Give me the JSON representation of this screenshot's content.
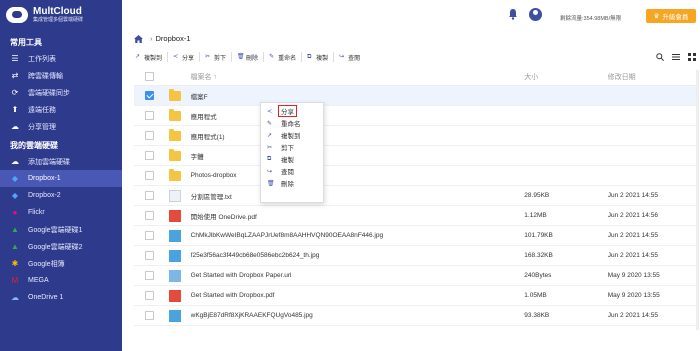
{
  "app": {
    "logo_title": "MultCloud",
    "logo_subtitle": "集成管理多個雲端硬碟",
    "brand_color": "#2e3a8c",
    "accent_color": "#3f8ff0"
  },
  "sidebar": {
    "tools_title": "常用工具",
    "tools": [
      {
        "label": "工作列表",
        "icon": "list-icon"
      },
      {
        "label": "跨雲碟傳輸",
        "icon": "transfer-icon"
      },
      {
        "label": "雲端硬碟同步",
        "icon": "sync-icon"
      },
      {
        "label": "遠端任務",
        "icon": "remote-icon"
      },
      {
        "label": "分享管理",
        "icon": "share-manage-icon"
      }
    ],
    "drives_title": "我的雲端硬碟",
    "drives": [
      {
        "label": "添加雲端硬碟",
        "icon": "add-cloud-icon"
      },
      {
        "label": "Dropbox-1",
        "icon": "dropbox-icon",
        "active": true
      },
      {
        "label": "Dropbox-2",
        "icon": "dropbox-icon"
      },
      {
        "label": "Flickr",
        "icon": "flickr-icon"
      },
      {
        "label": "Google雲端硬碟1",
        "icon": "google-drive-icon"
      },
      {
        "label": "Google雲端硬碟2",
        "icon": "google-drive-icon"
      },
      {
        "label": "Google相簿",
        "icon": "google-photos-icon"
      },
      {
        "label": "MEGA",
        "icon": "mega-icon"
      },
      {
        "label": "OneDrive 1",
        "icon": "onedrive-icon"
      }
    ]
  },
  "header": {
    "traffic_text": "剩餘流量:354.98MB/無限",
    "upgrade_label": "升級會員"
  },
  "breadcrumb": {
    "current": "Dropbox-1"
  },
  "toolbar": {
    "items": [
      {
        "label": "複製到",
        "icon": "copy-to-icon"
      },
      {
        "label": "分享",
        "icon": "share-icon"
      },
      {
        "label": "剪下",
        "icon": "cut-icon"
      },
      {
        "label": "刪除",
        "icon": "delete-icon"
      },
      {
        "label": "重命名",
        "icon": "rename-icon"
      },
      {
        "label": "複製",
        "icon": "copy-icon"
      },
      {
        "label": "查閱",
        "icon": "preview-icon"
      }
    ]
  },
  "table": {
    "col_name": "檔案名 ↑",
    "col_size": "大小",
    "col_date": "修改日期",
    "rows": [
      {
        "name": "檔案F",
        "type": "folder",
        "size": "",
        "date": "",
        "selected": true
      },
      {
        "name": "應用程式",
        "type": "folder",
        "size": "",
        "date": ""
      },
      {
        "name": "應用程式(1)",
        "type": "folder",
        "size": "",
        "date": ""
      },
      {
        "name": "字體",
        "type": "folder",
        "size": "",
        "date": ""
      },
      {
        "name": "Photos-dropbox",
        "type": "folder",
        "size": "",
        "date": ""
      },
      {
        "name": "分割區管理.txt",
        "type": "doc",
        "size": "28.95KB",
        "date": "Jun 2 2021 14:55"
      },
      {
        "name": "開始使用 OneDrive.pdf",
        "type": "pdf",
        "size": "1.12MB",
        "date": "Jun 2 2021 14:56"
      },
      {
        "name": "ChMkJlbKwWeIBqLZAAPJrUef8m8AAHHVQN90OEAA8nF446.jpg",
        "type": "img",
        "size": "101.79KB",
        "date": "Jun 2 2021 14:55"
      },
      {
        "name": "f25e3f56ac3f449cb68e0586ebc2b624_th.jpg",
        "type": "img",
        "size": "168.32KB",
        "date": "Jun 2 2021 14:55"
      },
      {
        "name": "Get Started with Dropbox Paper.url",
        "type": "url",
        "size": "240Bytes",
        "date": "May 9 2020 13:55"
      },
      {
        "name": "Get Started with Dropbox.pdf",
        "type": "pdf",
        "size": "1.05MB",
        "date": "May 9 2020 13:55"
      },
      {
        "name": "wKgBjE87dRf8XjKRAAEKFQUgVo485.jpg",
        "type": "img",
        "size": "93.38KB",
        "date": "Jun 2 2021 14:55"
      }
    ]
  },
  "context_menu": {
    "items": [
      {
        "label": "分享",
        "icon": "share-icon",
        "highlighted": true
      },
      {
        "label": "重命名",
        "icon": "rename-icon"
      },
      {
        "label": "複製到",
        "icon": "copy-to-icon"
      },
      {
        "label": "剪下",
        "icon": "cut-icon"
      },
      {
        "label": "複製",
        "icon": "copy-icon"
      },
      {
        "label": "查閱",
        "icon": "preview-icon"
      },
      {
        "label": "刪除",
        "icon": "delete-icon"
      }
    ]
  }
}
